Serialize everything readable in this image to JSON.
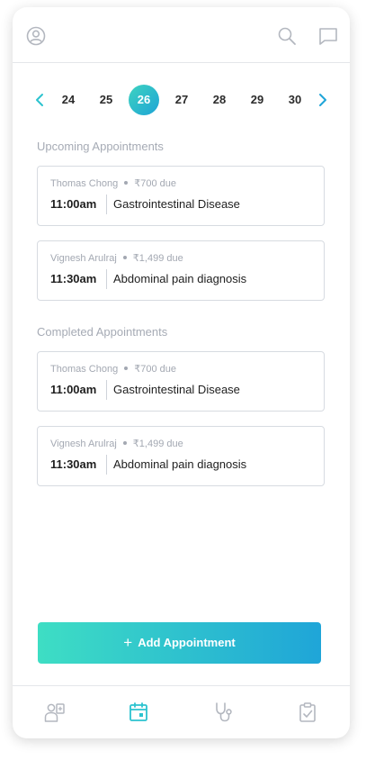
{
  "header": {
    "profile_icon": "profile-icon",
    "search_icon": "search-icon",
    "chat_icon": "chat-icon"
  },
  "dates": [
    "24",
    "25",
    "26",
    "27",
    "28",
    "29",
    "30"
  ],
  "selected_date": "26",
  "upcoming": {
    "title": "Upcoming Appointments",
    "items": [
      {
        "patient": "Thomas Chong",
        "due": "₹700 due",
        "time": "11:00am",
        "description": "Gastrointestinal Disease"
      },
      {
        "patient": "Vignesh Arulraj",
        "due": "₹1,499 due",
        "time": "11:30am",
        "description": "Abdominal pain diagnosis"
      }
    ]
  },
  "completed": {
    "title": "Completed Appointments",
    "items": [
      {
        "patient": "Thomas Chong",
        "due": "₹700 due",
        "time": "11:00am",
        "description": "Gastrointestinal Disease"
      },
      {
        "patient": "Vignesh Arulraj",
        "due": "₹1,499 due",
        "time": "11:30am",
        "description": "Abdominal pain diagnosis"
      }
    ]
  },
  "add_button": {
    "label": "Add Appointment",
    "icon": "plus-icon"
  },
  "nav": {
    "items": [
      "patients-icon",
      "calendar-icon",
      "stethoscope-icon",
      "clipboard-check-icon"
    ],
    "active": "calendar-icon"
  },
  "colors": {
    "accent": "#2cc3cf",
    "gradient_start": "#3edec4",
    "gradient_end": "#1fa5d8",
    "muted_text": "#a6abb5",
    "icon_gray": "#b3b7bf"
  }
}
